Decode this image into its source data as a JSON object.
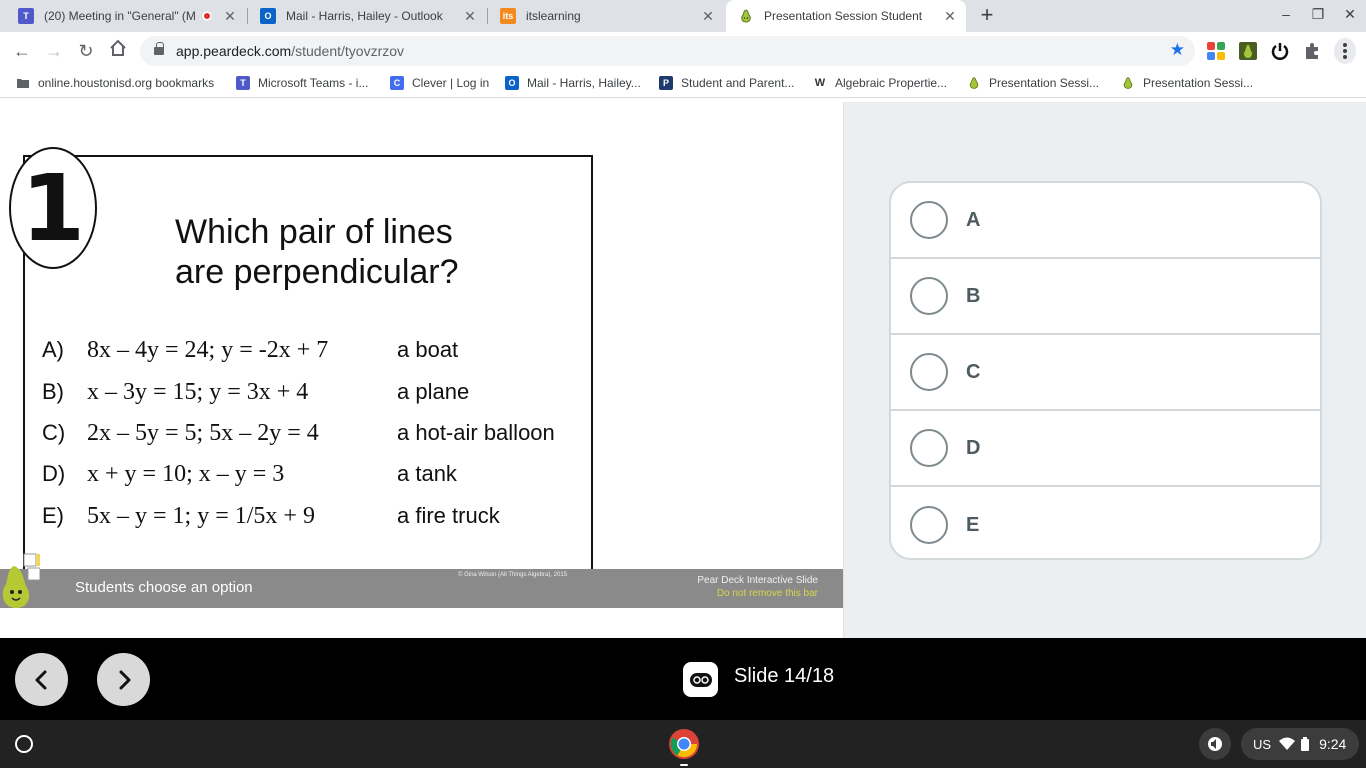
{
  "browser": {
    "tabs": [
      {
        "title": "(20) Meeting in \"General\" (M",
        "icon": "teams-icon",
        "recording": true
      },
      {
        "title": "Mail - Harris, Hailey - Outlook",
        "icon": "outlook-icon"
      },
      {
        "title": "itslearning",
        "icon": "itslearning-icon",
        "icon_text": "its"
      },
      {
        "title": "Presentation Session Student",
        "icon": "peardeck-icon",
        "active": true
      }
    ],
    "url": {
      "host": "app.peardeck.com",
      "path": "/student/tyovzrzov"
    },
    "bookmarks": [
      {
        "label": "online.houstonisd.org bookmarks",
        "icon": "folder-icon"
      },
      {
        "label": "Microsoft Teams - i...",
        "icon": "teams-icon"
      },
      {
        "label": "Clever | Log in",
        "icon": "clever-icon",
        "icon_text": "C"
      },
      {
        "label": "Mail - Harris, Hailey...",
        "icon": "outlook-icon"
      },
      {
        "label": "Student and Parent...",
        "icon": "powerschool-icon",
        "icon_text": "P"
      },
      {
        "label": "Algebraic Propertie...",
        "icon": "weebly-icon",
        "icon_text": "W"
      },
      {
        "label": "Presentation Sessi...",
        "icon": "peardeck-icon"
      },
      {
        "label": "Presentation Sessi...",
        "icon": "peardeck-icon"
      }
    ]
  },
  "slide": {
    "number": "1",
    "question": "Which pair of lines are perpendicular?",
    "options": [
      {
        "letter": "A)",
        "equation": "8x – 4y = 24;  y = -2x + 7",
        "answer": "a boat"
      },
      {
        "letter": "B)",
        "equation": "x – 3y = 15;  y = 3x + 4",
        "answer": "a plane"
      },
      {
        "letter": "C)",
        "equation": "2x – 5y = 5; 5x – 2y = 4",
        "answer": "a hot-air balloon"
      },
      {
        "letter": "D)",
        "equation": "x + y = 10; x – y = 3",
        "answer": "a tank"
      },
      {
        "letter": "E)",
        "equation": "5x – y = 1; y = 1/5x + 9",
        "answer": "a fire truck"
      }
    ],
    "credit": "© Gina Wilson (All Things Algebra), 2015",
    "bar_prompt": "Students choose an option",
    "bar_label": "Pear Deck Interactive Slide",
    "bar_warning": "Do not remove this bar"
  },
  "choices": [
    "A",
    "B",
    "C",
    "D",
    "E"
  ],
  "nav": {
    "slide_counter": "Slide 14/18"
  },
  "system": {
    "locale": "US",
    "time": "9:24"
  },
  "colors": {
    "accent": "#1a73e8",
    "bar_gray": "#8a8a8a",
    "pane_bg": "#eceff1"
  }
}
